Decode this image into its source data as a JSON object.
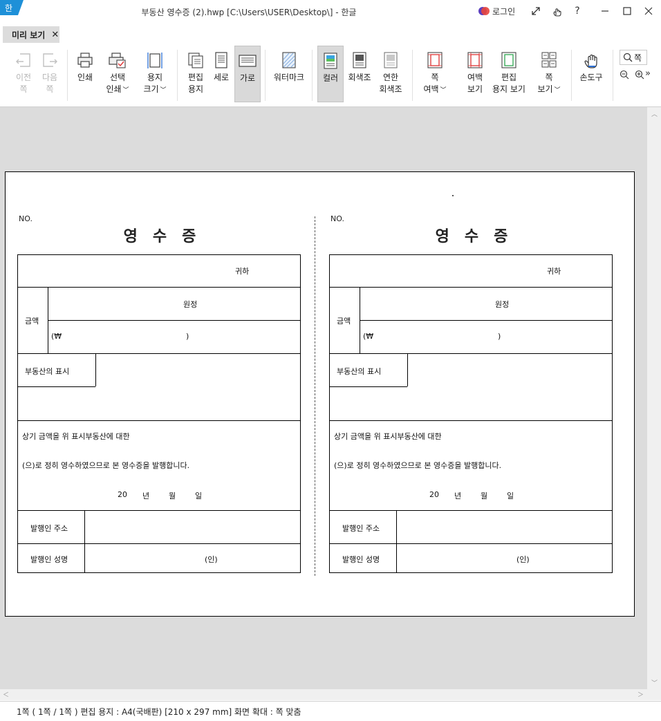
{
  "window": {
    "title": "부동산 영수증 (2).hwp [C:\\Users\\USER\\Desktop\\] - 한글",
    "app_logo_glyph": "한",
    "login_label": "로그인",
    "help_glyph": "?"
  },
  "tab": {
    "label": "미리 보기"
  },
  "ribbon": {
    "prev_page": [
      "이전",
      "쪽"
    ],
    "next_page": [
      "다음",
      "쪽"
    ],
    "print": "인쇄",
    "select_print": [
      "선택",
      "인쇄"
    ],
    "paper_size": [
      "용지",
      "크기"
    ],
    "edit_paper": [
      "편집",
      "용지"
    ],
    "portrait": "세로",
    "landscape": "가로",
    "watermark": "워터마크",
    "color": "컬러",
    "grayscale": "회색조",
    "light_grayscale": [
      "연한",
      "회색조"
    ],
    "page_margin": [
      "쪽",
      "여백"
    ],
    "margin_view": [
      "여백",
      "보기"
    ],
    "edit_paper_view": [
      "편집",
      "용지 보기"
    ],
    "page_view": [
      "쪽",
      "보기"
    ],
    "hand_tool": "손도구",
    "zoom_search": "쪽"
  },
  "receipt": {
    "no": "NO.",
    "title": "영수증",
    "recipient_suffix": "귀하",
    "amount_label": "금액",
    "won_label": "원정",
    "won_open": "(₩",
    "won_close": ")",
    "property_label": "부동산의 표시",
    "line1": "상기 금액을 위 표시부동산에 대한",
    "line2": "(으)로 정히 영수하였으므로 본 영수증을 발행합니다.",
    "date_year": "20",
    "date_y": "년",
    "date_m": "월",
    "date_d": "일",
    "issuer_address_label": "발행인 주소",
    "issuer_name_label": "발행인 성명",
    "seal": "(인)"
  },
  "status": {
    "text": "1쪽 ( 1쪽 / 1쪽 ) 편집 용지 : A4(국배판)  [210 x 297 mm]  화면 확대 : 쪽 맞춤"
  },
  "colors": {
    "accent": "#1e90d8",
    "workspace": "#dcdcdc",
    "active_button": "#d9d9d9"
  }
}
